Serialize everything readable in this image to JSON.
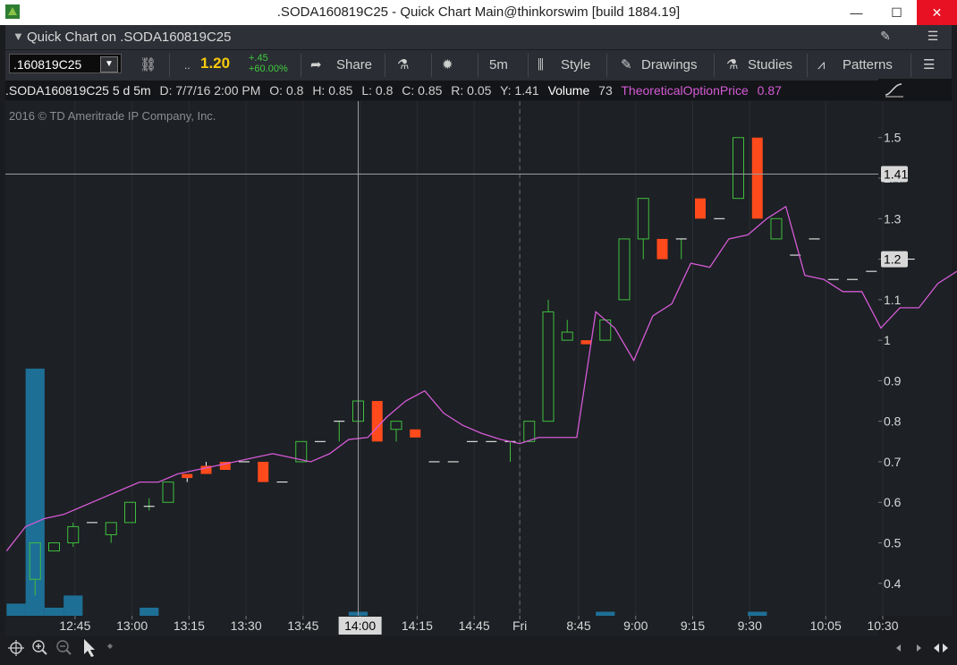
{
  "window": {
    "title": ".SODA160819C25 - Quick Chart Main@thinkorswim [build 1884.19]",
    "minimize": "—",
    "maximize": "☐",
    "close": "✕"
  },
  "header": {
    "title": "Quick Chart on .SODA160819C25"
  },
  "toolbar": {
    "symbol": ".160819C25",
    "dots": "..",
    "last_price": "1.20",
    "change": "+.45",
    "change_pct": "+60.00%",
    "share_label": "Share",
    "timeframe_label": "5m",
    "style_label": "Style",
    "drawings_label": "Drawings",
    "studies_label": "Studies",
    "patterns_label": "Patterns"
  },
  "info_line": {
    "symbol_period": ".SODA160819C25 5 d 5m",
    "date": "D: 7/7/16 2:00 PM",
    "open": "O: 0.8",
    "high": "H: 0.85",
    "low": "L: 0.8",
    "close": "C: 0.85",
    "range": "R: 0.05",
    "y": "Y: 1.41",
    "volume_label": "Volume",
    "volume_value": "73",
    "study_label": "TheoreticalOptionPrice",
    "study_value": "0.87"
  },
  "copyright": "2016 © TD Ameritrade IP Company, Inc.",
  "colors": {
    "up": "#3fbf3f",
    "down": "#ff4a1c",
    "study": "#d45ad6",
    "volume": "#1e6f96",
    "background": "#1d2024",
    "accent_price": "#f7c90a"
  },
  "chart_data": {
    "type": "candlestick",
    "ylim": [
      0.32,
      1.59
    ],
    "y_ticks": [
      0.4,
      0.5,
      0.6,
      0.7,
      0.8,
      0.9,
      1,
      1.1,
      1.2,
      1.3,
      1.4,
      1.5
    ],
    "y_tick_labels": [
      "0.4",
      "0.5",
      "0.6",
      "0.7",
      "0.8",
      "0.9",
      "1",
      "1.1",
      "1.2",
      "1.3",
      "1.4",
      "1.5"
    ],
    "x_labels": [
      {
        "i": 3.1,
        "label": "12:45"
      },
      {
        "i": 6.1,
        "label": "13:00"
      },
      {
        "i": 9.1,
        "label": "13:15"
      },
      {
        "i": 12.1,
        "label": "13:30"
      },
      {
        "i": 15.1,
        "label": "13:45"
      },
      {
        "i": 18.1,
        "label": "14:00",
        "highlight": true
      },
      {
        "i": 21.1,
        "label": "14:15"
      },
      {
        "i": 24.1,
        "label": "14:45"
      },
      {
        "i": 26.5,
        "label": "Fri"
      },
      {
        "i": 29.6,
        "label": "8:45"
      },
      {
        "i": 32.6,
        "label": "9:00"
      },
      {
        "i": 35.6,
        "label": "9:15"
      },
      {
        "i": 38.6,
        "label": "9:30"
      },
      {
        "i": 42.6,
        "label": "10:05"
      },
      {
        "i": 45.6,
        "label": "10:30"
      }
    ],
    "session_breaks": [
      26
    ],
    "crosshair": {
      "index": 18,
      "price": 1.41
    },
    "price_tags": [
      {
        "value": 1.41,
        "label": "1.41"
      },
      {
        "value": 1.2,
        "label": "1.2"
      }
    ],
    "candles": [
      {
        "o": null,
        "h": null,
        "l": null,
        "c": null,
        "v": 0.35
      },
      {
        "o": 0.41,
        "h": 0.5,
        "l": 0.37,
        "c": 0.5,
        "v": 0.93
      },
      {
        "o": 0.48,
        "h": 0.5,
        "l": 0.48,
        "c": 0.5,
        "v": 0.34
      },
      {
        "o": 0.5,
        "h": 0.55,
        "l": 0.49,
        "c": 0.54,
        "v": 0.37
      },
      {
        "o": 0.55,
        "h": 0.55,
        "l": 0.55,
        "c": 0.55,
        "v": 0.31
      },
      {
        "o": 0.52,
        "h": 0.55,
        "l": 0.5,
        "c": 0.55,
        "v": 0.31
      },
      {
        "o": 0.55,
        "h": 0.6,
        "l": 0.55,
        "c": 0.6,
        "v": 0.31
      },
      {
        "o": 0.59,
        "h": 0.61,
        "l": 0.58,
        "c": 0.59,
        "v": 0.34
      },
      {
        "o": 0.6,
        "h": 0.65,
        "l": 0.6,
        "c": 0.65,
        "v": 0.32
      },
      {
        "o": 0.67,
        "h": 0.67,
        "l": 0.65,
        "c": 0.66,
        "v": 0.32
      },
      {
        "o": 0.69,
        "h": 0.7,
        "l": 0.67,
        "c": 0.67,
        "v": 0.31
      },
      {
        "o": 0.7,
        "h": 0.7,
        "l": 0.68,
        "c": 0.68,
        "v": 0.32
      },
      {
        "o": 0.7,
        "h": 0.7,
        "l": 0.7,
        "c": 0.7,
        "v": 0.32
      },
      {
        "o": 0.7,
        "h": 0.7,
        "l": 0.65,
        "c": 0.65,
        "v": 0.32
      },
      {
        "o": 0.65,
        "h": 0.65,
        "l": 0.65,
        "c": 0.65,
        "v": 0.31
      },
      {
        "o": 0.7,
        "h": 0.75,
        "l": 0.7,
        "c": 0.75,
        "v": 0.32
      },
      {
        "o": 0.75,
        "h": 0.75,
        "l": 0.75,
        "c": 0.75,
        "v": 0.31
      },
      {
        "o": 0.8,
        "h": 0.8,
        "l": 0.75,
        "c": 0.8,
        "v": 0.32
      },
      {
        "o": 0.8,
        "h": 0.85,
        "l": 0.8,
        "c": 0.85,
        "v": 0.33
      },
      {
        "o": 0.85,
        "h": 0.85,
        "l": 0.75,
        "c": 0.75,
        "v": 0.32
      },
      {
        "o": 0.78,
        "h": 0.8,
        "l": 0.75,
        "c": 0.8,
        "v": 0.31
      },
      {
        "o": 0.78,
        "h": 0.78,
        "l": 0.76,
        "c": 0.76,
        "v": 0.31
      },
      {
        "o": 0.7,
        "h": 0.7,
        "l": 0.7,
        "c": 0.7,
        "v": 0.31
      },
      {
        "o": 0.7,
        "h": 0.7,
        "l": 0.7,
        "c": 0.7,
        "v": 0.31
      },
      {
        "o": 0.75,
        "h": 0.75,
        "l": 0.75,
        "c": 0.75,
        "v": 0.32
      },
      {
        "o": 0.75,
        "h": 0.75,
        "l": 0.75,
        "c": 0.75,
        "v": 0.31
      },
      {
        "o": 0.75,
        "h": 0.75,
        "l": 0.7,
        "c": 0.75,
        "v": 0.31
      },
      {
        "o": 0.75,
        "h": 0.8,
        "l": 0.75,
        "c": 0.8,
        "v": 0.32
      },
      {
        "o": 0.8,
        "h": 1.1,
        "l": 0.8,
        "c": 1.07,
        "v": 0.32
      },
      {
        "o": 1.0,
        "h": 1.05,
        "l": 1.0,
        "c": 1.02,
        "v": 0.31
      },
      {
        "o": 1.0,
        "h": 1.0,
        "l": 0.99,
        "c": 0.99,
        "v": 0.32
      },
      {
        "o": 1.0,
        "h": 1.05,
        "l": 1.0,
        "c": 1.05,
        "v": 0.33
      },
      {
        "o": 1.1,
        "h": 1.25,
        "l": 1.1,
        "c": 1.25,
        "v": 0.32
      },
      {
        "o": 1.25,
        "h": 1.35,
        "l": 1.2,
        "c": 1.35,
        "v": 0.32
      },
      {
        "o": 1.25,
        "h": 1.25,
        "l": 1.2,
        "c": 1.2,
        "v": 0.31
      },
      {
        "o": 1.25,
        "h": 1.25,
        "l": 1.2,
        "c": 1.25,
        "v": 0.31
      },
      {
        "o": 1.35,
        "h": 1.35,
        "l": 1.3,
        "c": 1.3,
        "v": 0.32
      },
      {
        "o": 1.3,
        "h": 1.3,
        "l": 1.3,
        "c": 1.3,
        "v": 0.31
      },
      {
        "o": 1.35,
        "h": 1.5,
        "l": 1.35,
        "c": 1.5,
        "v": 0.32
      },
      {
        "o": 1.5,
        "h": 1.5,
        "l": 1.3,
        "c": 1.3,
        "v": 0.33
      },
      {
        "o": 1.25,
        "h": 1.3,
        "l": 1.25,
        "c": 1.3,
        "v": 0.31
      },
      {
        "o": 1.21,
        "h": 1.21,
        "l": 1.21,
        "c": 1.21,
        "v": 0.31
      },
      {
        "o": 1.25,
        "h": 1.25,
        "l": 1.25,
        "c": 1.25,
        "v": 0.31
      },
      {
        "o": 1.15,
        "h": 1.15,
        "l": 1.15,
        "c": 1.15,
        "v": 0.31
      },
      {
        "o": 1.15,
        "h": 1.15,
        "l": 1.15,
        "c": 1.15,
        "v": 0.31
      },
      {
        "o": 1.17,
        "h": 1.17,
        "l": 1.17,
        "c": 1.17,
        "v": 0.31
      },
      {
        "o": 1.2,
        "h": 1.2,
        "l": 1.2,
        "c": 1.2,
        "v": 0.31
      },
      {
        "o": 1.2,
        "h": 1.2,
        "l": 1.2,
        "c": 1.2,
        "v": 0.31
      }
    ],
    "study_series": {
      "name": "TheoreticalOptionPrice",
      "values": [
        0.48,
        0.54,
        0.56,
        0.57,
        0.59,
        0.61,
        0.63,
        0.65,
        0.65,
        0.67,
        0.68,
        0.69,
        0.7,
        0.71,
        0.72,
        0.71,
        0.7,
        0.72,
        0.755,
        0.76,
        0.81,
        0.85,
        0.875,
        0.82,
        0.79,
        0.77,
        0.755,
        0.745,
        0.76,
        0.76,
        0.76,
        1.07,
        1.03,
        0.95,
        1.06,
        1.09,
        1.19,
        1.18,
        1.25,
        1.26,
        1.3,
        1.33,
        1.16,
        1.15,
        1.12,
        1.12,
        1.03,
        1.08,
        1.08,
        1.14,
        1.17
      ]
    },
    "study_x_offset": -0.5
  }
}
